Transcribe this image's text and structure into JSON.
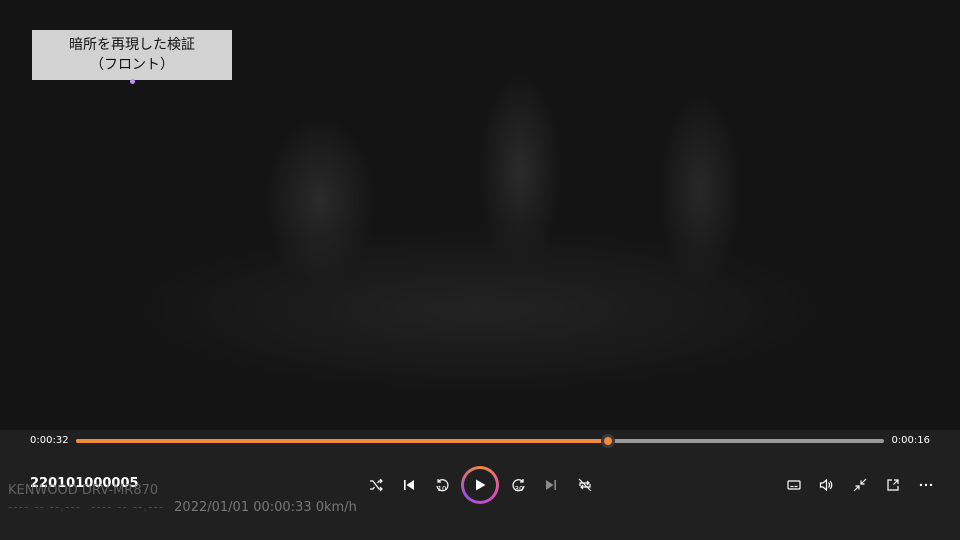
{
  "video": {
    "caption_line1": "暗所を再現した検証",
    "caption_line2": "（フロント）",
    "overlay_brand": "KENWOOD DRV-MR870",
    "overlay_dashes1": "---- -- --.---",
    "overlay_dashes2": "---- -- --.---",
    "overlay_stamp": "2022/01/01 00:00:33 0km/h"
  },
  "player": {
    "elapsed": "0:00:32",
    "remaining": "0:00:16",
    "progress": 0.658,
    "title": "220101000005",
    "skip_back_label": "10",
    "skip_forward_label": "30",
    "accent_color": "#f08a3c"
  },
  "icons": {
    "shuffle": "shuffle-icon",
    "previous": "previous-icon",
    "skip_back": "skip-back-10-icon",
    "play": "play-icon",
    "skip_forward": "skip-forward-30-icon",
    "next": "next-icon",
    "repeat_off": "repeat-off-icon",
    "subtitles": "subtitles-icon",
    "volume": "volume-icon",
    "exit_fullscreen": "exit-fullscreen-icon",
    "mini_player": "mini-player-icon",
    "more": "more-icon"
  }
}
